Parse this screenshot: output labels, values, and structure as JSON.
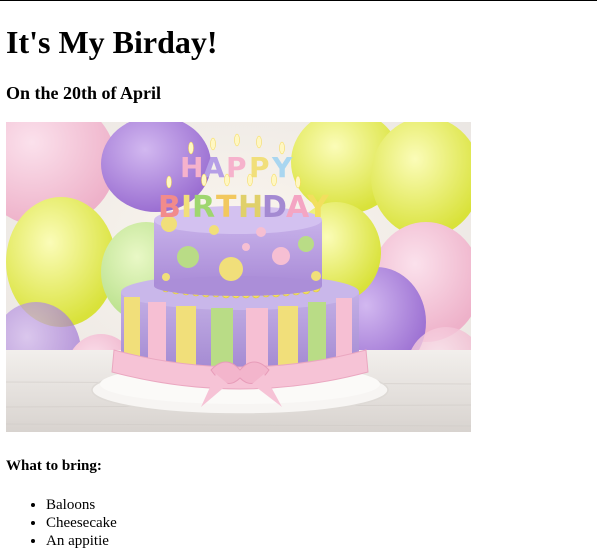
{
  "page": {
    "title": "It's My Birday!",
    "date_line": "On the 20th of April",
    "image": {
      "subject": "birthday-cake-image",
      "lettering": "HAPPY BIRTHDAY",
      "colors": {
        "balloon_purple": "#b58ee0",
        "balloon_yellow": "#eef26a",
        "cake_lavender": "#b9a0df",
        "cake_pink": "#f6bfd3",
        "cake_yellow": "#f2e37a",
        "cake_green": "#b9dc86",
        "plate_white": "#f4f1ee"
      }
    },
    "bring_heading": "What to bring:",
    "bring_items": [
      "Baloons",
      "Cheesecake",
      "An appitie"
    ]
  }
}
